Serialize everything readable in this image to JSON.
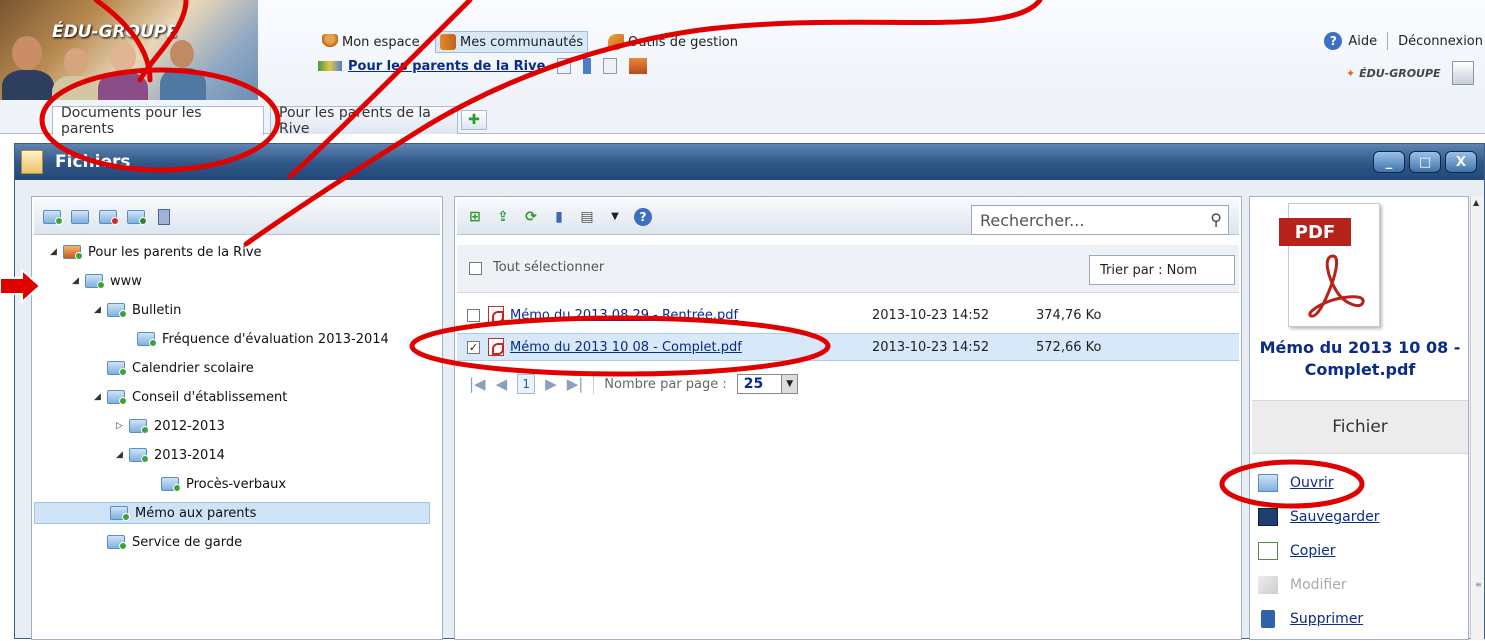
{
  "header": {
    "brand": "ÉDU-GROUPE",
    "brand_small": "ÉDU-GROUPE",
    "nav": [
      {
        "label": "Mon espace"
      },
      {
        "label": "Mes communautés"
      },
      {
        "label": "Outils de gestion"
      }
    ],
    "context_link": "Pour les parents de la Rive",
    "help": "Aide",
    "logout": "Déconnexion"
  },
  "tabs": [
    {
      "label": "Documents pour les parents",
      "active": true
    },
    {
      "label": "Pour les parents de la Rive",
      "active": false
    }
  ],
  "window": {
    "title": "Fichiers",
    "buttons": {
      "minimize": "_",
      "maximize": "□",
      "close": "X"
    }
  },
  "tree": {
    "items": [
      {
        "label": "Pour les parents de la Rive",
        "expanded": true
      },
      {
        "label": "www",
        "expanded": true
      },
      {
        "label": "Bulletin",
        "expanded": true
      },
      {
        "label": "Fréquence d'évaluation 2013-2014"
      },
      {
        "label": "Calendrier scolaire"
      },
      {
        "label": "Conseil d'établissement",
        "expanded": true
      },
      {
        "label": "2012-2013",
        "expanded": false
      },
      {
        "label": "2013-2014",
        "expanded": true
      },
      {
        "label": "Procès-verbaux"
      },
      {
        "label": "Mémo aux parents",
        "selected": true
      },
      {
        "label": "Service de garde"
      }
    ]
  },
  "files": {
    "search_placeholder": "Rechercher...",
    "select_all": "Tout sélectionner",
    "sort": "Trier par : Nom",
    "rows": [
      {
        "name": "Mémo du 2013 08 29 - Rentrée.pdf",
        "date": "2013-10-23 14:52",
        "size": "374,76 Ko",
        "checked": false
      },
      {
        "name": "Mémo du 2013 10 08 - Complet.pdf",
        "date": "2013-10-23 14:52",
        "size": "572,66 Ko",
        "checked": true
      }
    ],
    "pager": {
      "current_page": "1",
      "per_page_label": "Nombre par page :",
      "per_page_value": "25"
    }
  },
  "details": {
    "pdf_tag": "PDF",
    "file_name": "Mémo du 2013 10 08 - Complet.pdf",
    "section": "Fichier",
    "actions": [
      {
        "label": "Ouvrir",
        "enabled": true
      },
      {
        "label": "Sauvegarder",
        "enabled": true
      },
      {
        "label": "Copier",
        "enabled": true
      },
      {
        "label": "Modifier",
        "enabled": false
      },
      {
        "label": "Supprimer",
        "enabled": true
      }
    ]
  },
  "colors": {
    "link": "#0a2b8a",
    "titlebar": "#2e5686",
    "annotation": "#e00000",
    "selection": "#d7e8f8"
  }
}
